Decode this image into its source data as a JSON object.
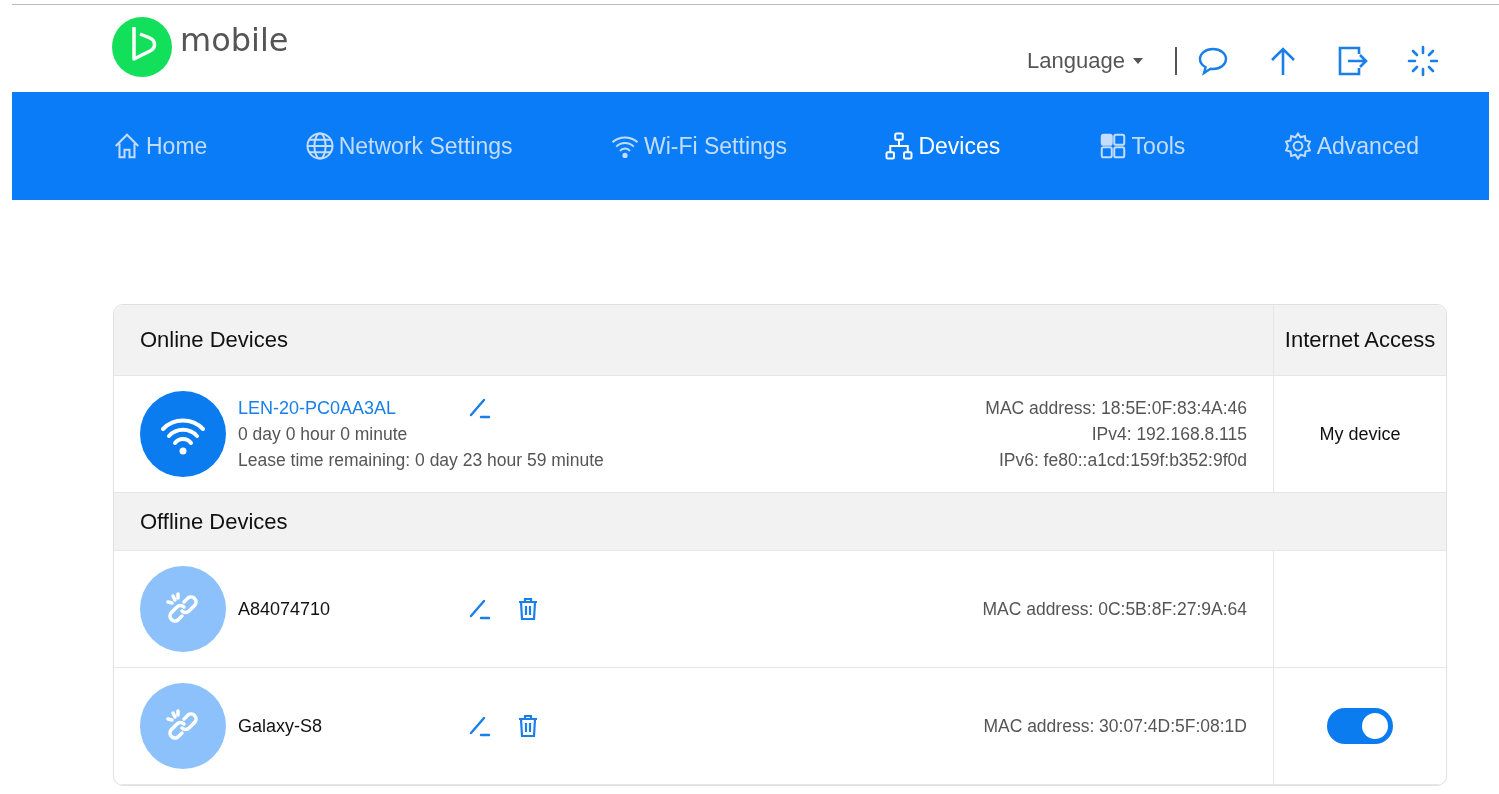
{
  "header": {
    "logo_text": "mobile",
    "language": "Language",
    "actions": [
      {
        "kind": "chat"
      },
      {
        "kind": "upload"
      },
      {
        "kind": "logout"
      },
      {
        "kind": "spinner"
      }
    ]
  },
  "nav": [
    {
      "label": "Home",
      "kind": "home",
      "selected": false
    },
    {
      "label": "Network Settings",
      "kind": "globe",
      "selected": false
    },
    {
      "label": "Wi-Fi Settings",
      "kind": "wifi",
      "selected": false
    },
    {
      "label": "Devices",
      "kind": "devices",
      "selected": true
    },
    {
      "label": "Tools",
      "kind": "tools",
      "selected": false
    },
    {
      "label": "Advanced",
      "kind": "gear",
      "selected": false
    }
  ],
  "table": {
    "online_title": "Online Devices",
    "access_title": "Internet Access",
    "online": [
      {
        "name": "LEN-20-PC0AA3AL",
        "connected": "0 day 0 hour 0 minute",
        "lease": "Lease time remaining: 0 day 23 hour 59 minute",
        "details": [
          "MAC address: 18:5E:0F:83:4A:46",
          "IPv4: 192.168.8.115",
          "IPv6: fe80::a1cd:159f:b352:9f0d"
        ],
        "access": {
          "kind": "text",
          "text": "My device"
        }
      }
    ],
    "offline_title": "Offline Devices",
    "offline": [
      {
        "name": "A84074710",
        "details": [
          "MAC address: 0C:5B:8F:27:9A:64"
        ]
      },
      {
        "name": "Galaxy-S8",
        "details": [
          "MAC address: 30:07:4D:5F:08:1D"
        ],
        "access": {
          "kind": "toggle",
          "on": true
        }
      }
    ]
  }
}
